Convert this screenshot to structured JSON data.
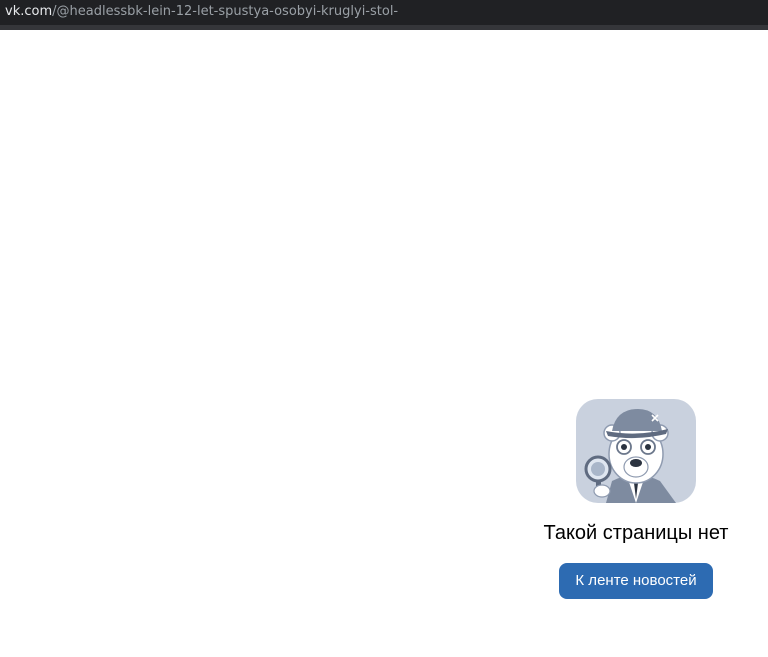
{
  "browser": {
    "url_host": "vk.com",
    "url_path": "/@headlessbk-lein-12-let-spustya-osobyi-kruglyi-stol-"
  },
  "error_page": {
    "illustration_icon": "detective-bear-with-magnifier",
    "title": "Такой страницы нет",
    "button_label": "К ленте новостей"
  },
  "colors": {
    "button_bg": "#2d6bb2",
    "illustration_bg": "#c9d1de"
  }
}
